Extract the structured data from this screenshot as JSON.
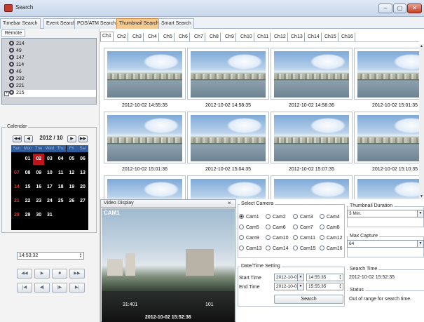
{
  "window": {
    "title": "Search",
    "minimize": "–",
    "maximize": "▢",
    "close": "✕"
  },
  "top_tabs": [
    "Timebar Search",
    "Event Search",
    "POS/ATM Search",
    "Thumbnail Search",
    "Smart Search"
  ],
  "active_top_tab": "Thumbnail Search",
  "remote": {
    "tab_label": "Remote",
    "items": [
      "214",
      "49",
      "147",
      "114",
      "46",
      "232",
      "221",
      "215"
    ],
    "selected": "215",
    "expander": "+"
  },
  "calendar": {
    "caption": "Calendar",
    "month_label": "2012 / 10",
    "nav": [
      "◀◀",
      "◀",
      "▶",
      "▶▶"
    ],
    "day_headers": [
      "Sun",
      "Mon",
      "Tue",
      "Wed",
      "Thu",
      "Fri",
      "Sat"
    ],
    "weeks": [
      [
        "",
        "01",
        "02",
        "03",
        "04",
        "05",
        "06"
      ],
      [
        "07",
        "08",
        "09",
        "10",
        "11",
        "12",
        "13"
      ],
      [
        "14",
        "15",
        "16",
        "17",
        "18",
        "19",
        "20"
      ],
      [
        "21",
        "22",
        "23",
        "24",
        "25",
        "26",
        "27"
      ],
      [
        "28",
        "29",
        "30",
        "31",
        "",
        "",
        ""
      ]
    ],
    "selected_day": "02"
  },
  "time_field": "14:53:32",
  "playback_buttons": [
    "◀◀",
    "▶",
    "■",
    "▶▶",
    "|◀",
    "◀|",
    "|▶",
    "▶|"
  ],
  "channel_tabs": [
    "Ch1",
    "Ch2",
    "Ch3",
    "Ch4",
    "Ch5",
    "Ch6",
    "Ch7",
    "Ch8",
    "Ch9",
    "Ch10",
    "Ch11",
    "Ch12",
    "Ch13",
    "Ch14",
    "Ch15",
    "Ch16"
  ],
  "active_channel": "Ch1",
  "thumbnails": [
    "2012-10-02 14:55:35",
    "2012-10-02 14:58:35",
    "2012-10-02 14:58:36",
    "2012-10-02 15:01:35",
    "2012-10-02 15:01:36",
    "2012-10-02 15:04:35",
    "2012-10-02 15:07:35",
    "2012-10-02 15:10:35",
    "",
    "",
    "",
    ""
  ],
  "video": {
    "title": "Video Display",
    "close": "×",
    "osd_top": "CAM1",
    "osd_left": "31:401",
    "osd_right": "101",
    "osd_time": "2012-10-02 15:52:36"
  },
  "select_camera": {
    "caption": "Select Camera",
    "cameras": [
      "Cam1",
      "Cam2",
      "Cam3",
      "Cam4",
      "Cam5",
      "Cam6",
      "Cam7",
      "Cam8",
      "Cam9",
      "Cam10",
      "Cam11",
      "Cam12",
      "Cam13",
      "Cam14",
      "Cam15",
      "Cam16"
    ],
    "selected": "Cam1"
  },
  "datetime": {
    "caption": "Date/Time Setting",
    "start_label": "Start Time",
    "end_label": "End Time",
    "start_date": "2012-10-02",
    "start_time": "14:55:35",
    "end_date": "2012-10-02",
    "end_time": "15:55:35",
    "search_button": "Search"
  },
  "thumbnail_duration": {
    "caption": "Thumbnail Duration",
    "value": "3 Min."
  },
  "max_capture": {
    "caption": "Max Capture",
    "value": "64"
  },
  "search_time": {
    "caption": "Search Time",
    "value": "2012-10-02 15:52:35"
  },
  "status": {
    "caption": "Status",
    "value": "Out of range for search time."
  }
}
